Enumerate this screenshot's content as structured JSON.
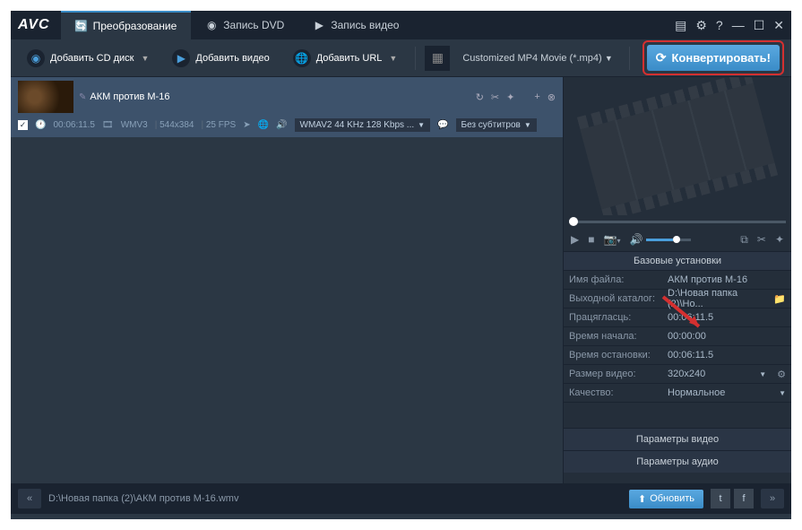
{
  "logo": "AVC",
  "tabs": {
    "convert": "Преобразование",
    "dvd": "Запись DVD",
    "video": "Запись видео"
  },
  "toolbar": {
    "add_cd": "Добавить CD диск",
    "add_video": "Добавить видео",
    "add_url": "Добавить URL",
    "profile": "Customized MP4 Movie (*.mp4)",
    "convert": "Конвертировать!"
  },
  "file": {
    "title": "АКМ против М-16",
    "duration": "00:06:11.5",
    "codec": "WMV3",
    "resolution": "544x384",
    "fps": "25 FPS",
    "audio": "WMAV2 44 KHz 128 Kbps ...",
    "subtitle": "Без субтитров"
  },
  "settings": {
    "header": "Базовые установки",
    "rows": {
      "filename_lbl": "Имя файла:",
      "filename_val": "АКМ против М-16",
      "outdir_lbl": "Выходной каталог:",
      "outdir_val": "D:\\Новая папка (2)\\Но...",
      "length_lbl": "Працягласць:",
      "length_val": "00:06:11.5",
      "start_lbl": "Время начала:",
      "start_val": "00:00:00",
      "stop_lbl": "Время остановки:",
      "stop_val": "00:06:11.5",
      "size_lbl": "Размер видео:",
      "size_val": "320x240",
      "quality_lbl": "Качество:",
      "quality_val": "Нормальное"
    },
    "video_params": "Параметры видео",
    "audio_params": "Параметры аудио"
  },
  "status": {
    "path": "D:\\Новая папка (2)\\АКМ против М-16.wmv",
    "update": "Обновить"
  }
}
